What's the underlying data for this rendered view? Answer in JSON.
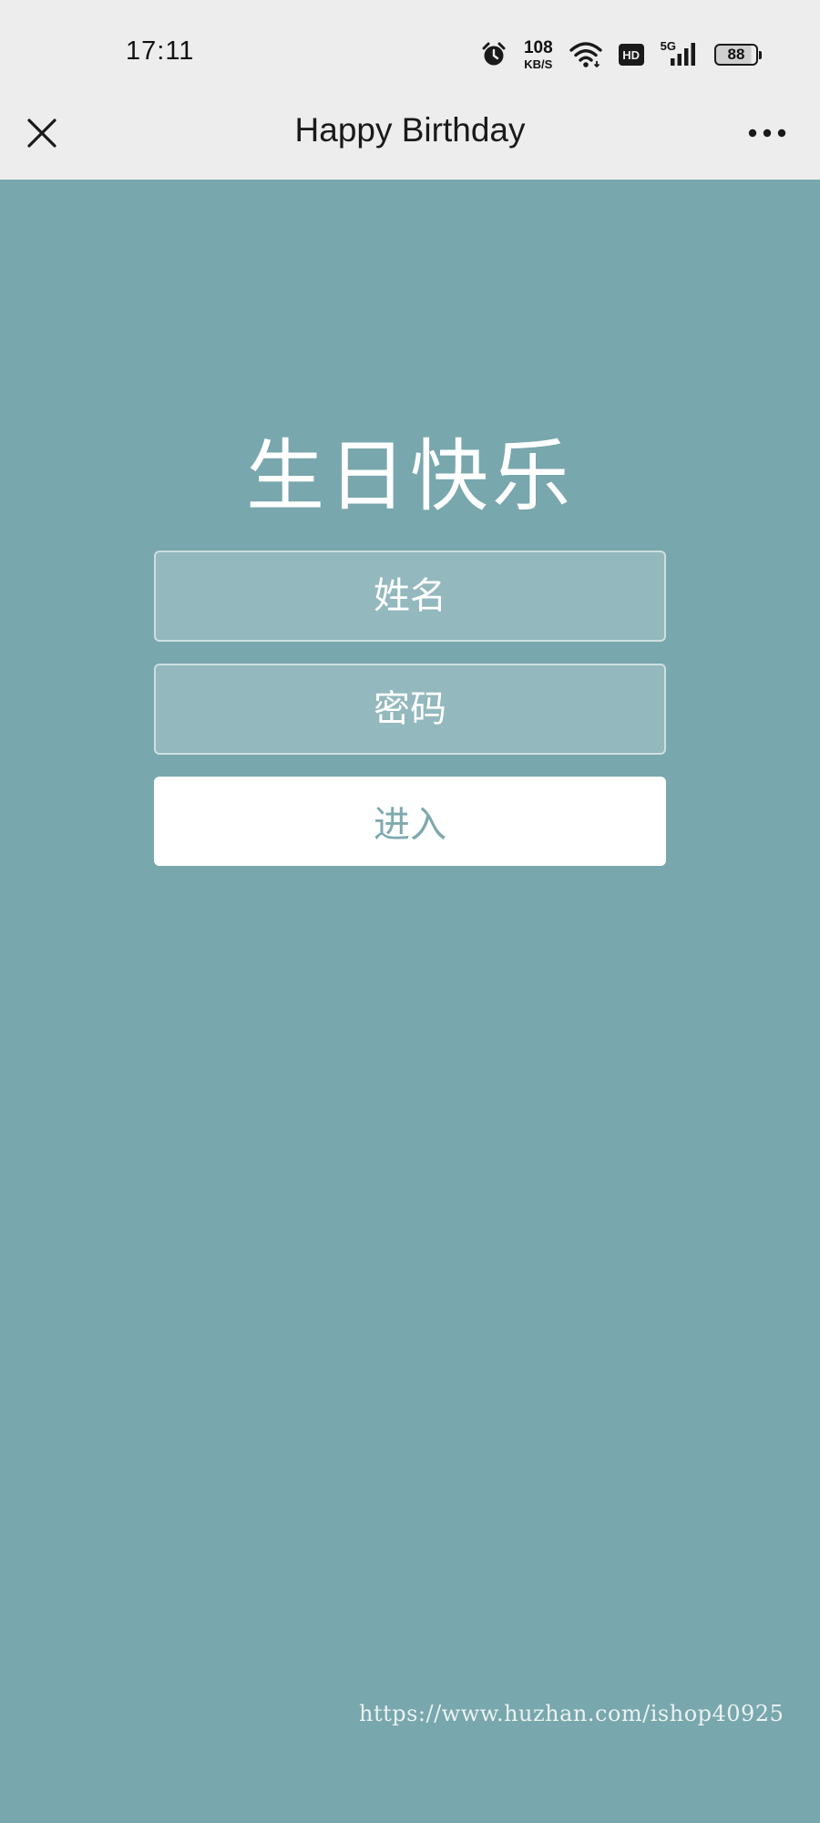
{
  "status_bar": {
    "time": "17:11",
    "net_speed_value": "108",
    "net_speed_unit": "KB/S",
    "hd_label": "HD",
    "network_gen": "5G",
    "battery_level": "88",
    "icons": [
      "alarm-icon",
      "wifi-icon",
      "signal-icon",
      "battery-icon"
    ]
  },
  "title_bar": {
    "title": "Happy Birthday",
    "close_icon": "close-icon",
    "more_icon": "more-icon"
  },
  "main": {
    "heading": "生日快乐",
    "name_placeholder": "姓名",
    "password_placeholder": "密码",
    "enter_label": "进入"
  },
  "watermark": "https://www.huzhan.com/ishop40925",
  "colors": {
    "background": "#78a7ad",
    "bar": "#ededed",
    "button_text": "#7ea9ae"
  }
}
